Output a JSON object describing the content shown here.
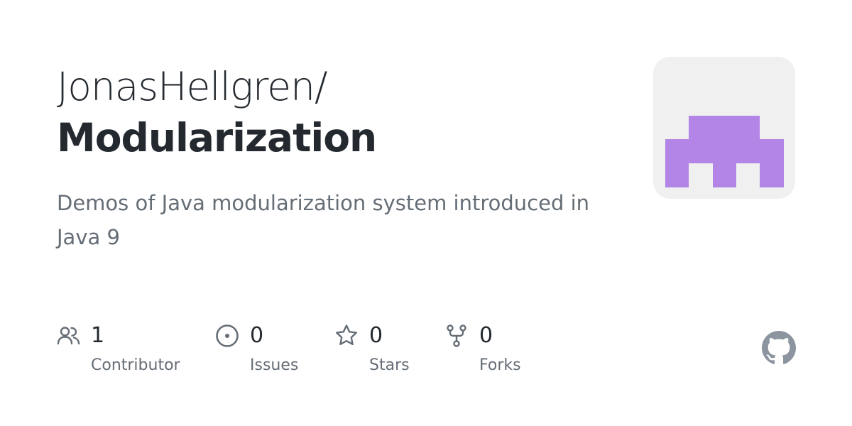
{
  "repo": {
    "owner": "JonasHellgren/",
    "name": "Modularization",
    "description": "Demos of Java modularization system introduced in Java 9"
  },
  "stats": {
    "contributors": {
      "count": "1",
      "label": "Contributor"
    },
    "issues": {
      "count": "0",
      "label": "Issues"
    },
    "stars": {
      "count": "0",
      "label": "Stars"
    },
    "forks": {
      "count": "0",
      "label": "Forks"
    }
  },
  "icons": {
    "contributors": "people-icon",
    "issues": "issue-opened-icon",
    "stars": "star-icon",
    "forks": "repo-forked-icon",
    "brand": "github-mark-icon"
  },
  "colors": {
    "text_primary": "#24292f",
    "text_muted": "#656d76",
    "avatar_background": "#f0f0f0",
    "avatar_identicon": "#b385e6",
    "github_mark": "#8c959f"
  }
}
